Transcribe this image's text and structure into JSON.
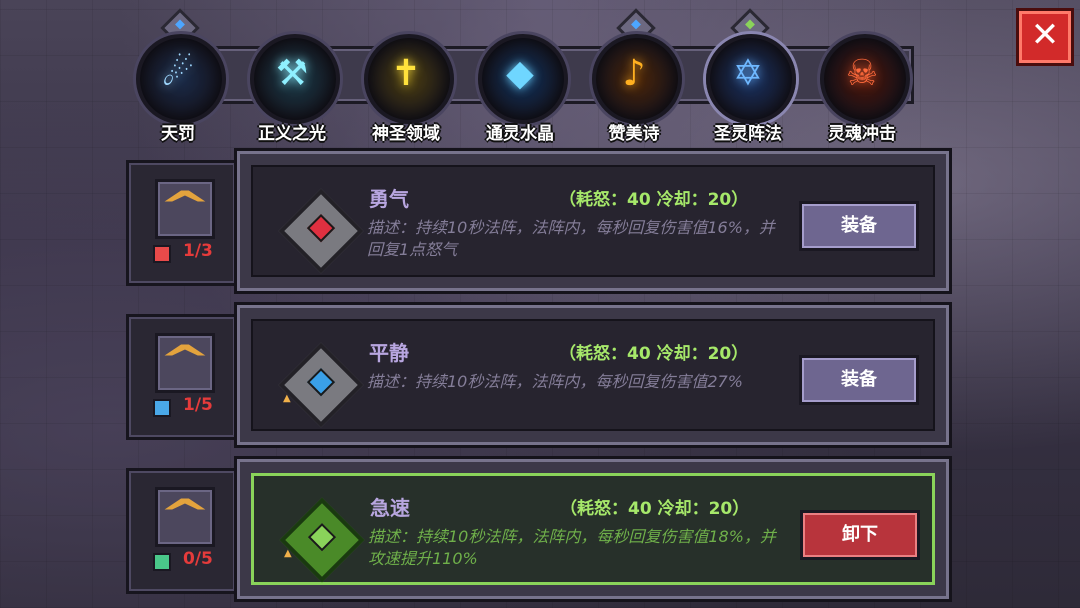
{
  "skills": [
    {
      "label": "天罚",
      "glyph": "☄",
      "color": "#9fd8ff",
      "bg": "#1a2a48",
      "pin": "#4da6ff"
    },
    {
      "label": "正义之光",
      "glyph": "⚒",
      "color": "#8ff0ff",
      "bg": "#1a3a48",
      "pin": null
    },
    {
      "label": "神圣领域",
      "glyph": "✝",
      "color": "#ffe23c",
      "bg": "#4a3c10",
      "pin": null
    },
    {
      "label": "通灵水晶",
      "glyph": "◆",
      "color": "#6fd6ff",
      "bg": "#10305a",
      "pin": null
    },
    {
      "label": "赞美诗",
      "glyph": "♪",
      "color": "#ffb020",
      "bg": "#4a2408",
      "pin": "#4da6ff"
    },
    {
      "label": "圣灵阵法",
      "glyph": "✡",
      "color": "#6fb8ff",
      "bg": "#183060",
      "pin": "#8ad35a",
      "selected": true
    },
    {
      "label": "灵魂冲击",
      "glyph": "☠",
      "color": "#ff6a3c",
      "bg": "#4a1408",
      "pin": null
    }
  ],
  "close_label": "✕",
  "runes": [
    {
      "name": "勇气",
      "cost": "（耗怒：40  冷却：20）",
      "desc": "描述：持续10秒法阵，法阵内，每秒回复伤害值16%，并回复1点怒气",
      "button": "装备",
      "level": "1/3",
      "level_icon_color": "#e84a4a",
      "gem_color": "#e03040",
      "upgrade": "^",
      "active": false
    },
    {
      "name": "平静",
      "cost": "（耗怒：40  冷却：20）",
      "desc": "描述：持续10秒法阵，法阵内，每秒回复伤害值27%",
      "button": "装备",
      "level": "1/5",
      "level_icon_color": "#4aa8e8",
      "gem_color": "#3aa0e8",
      "upgrade": "^",
      "active": false
    },
    {
      "name": "急速",
      "cost": "（耗怒：40  冷却：20）",
      "desc": "描述：持续10秒法阵，法阵内，每秒回复伤害值18%，并攻速提升110%",
      "button": "卸下",
      "level": "0/5",
      "level_icon_color": "#4ac88a",
      "gem_color": "#8ad35a",
      "upgrade": "^",
      "active": true
    }
  ]
}
